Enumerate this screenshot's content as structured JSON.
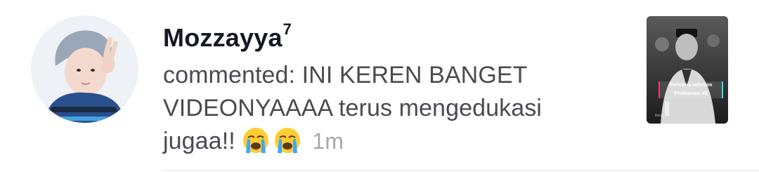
{
  "notification": {
    "username": "Mozzayya",
    "username_superscript": "7",
    "comment_prefix": "commented: ",
    "comment_text": "INI KEREN BANGET VIDEONYAAAA terus mengedukasi jugaa!!",
    "emojis": [
      "loudly-crying-face",
      "loudly-crying-face"
    ],
    "time": "1m"
  },
  "video_thumbnail": {
    "caption_line1": "Peristiwa sebelum",
    "caption_line2": "Proklamasi #2"
  },
  "colors": {
    "username": "#161823",
    "comment": "#4a4b52",
    "time": "#a8a9ae",
    "divider": "#e3e3e4"
  }
}
